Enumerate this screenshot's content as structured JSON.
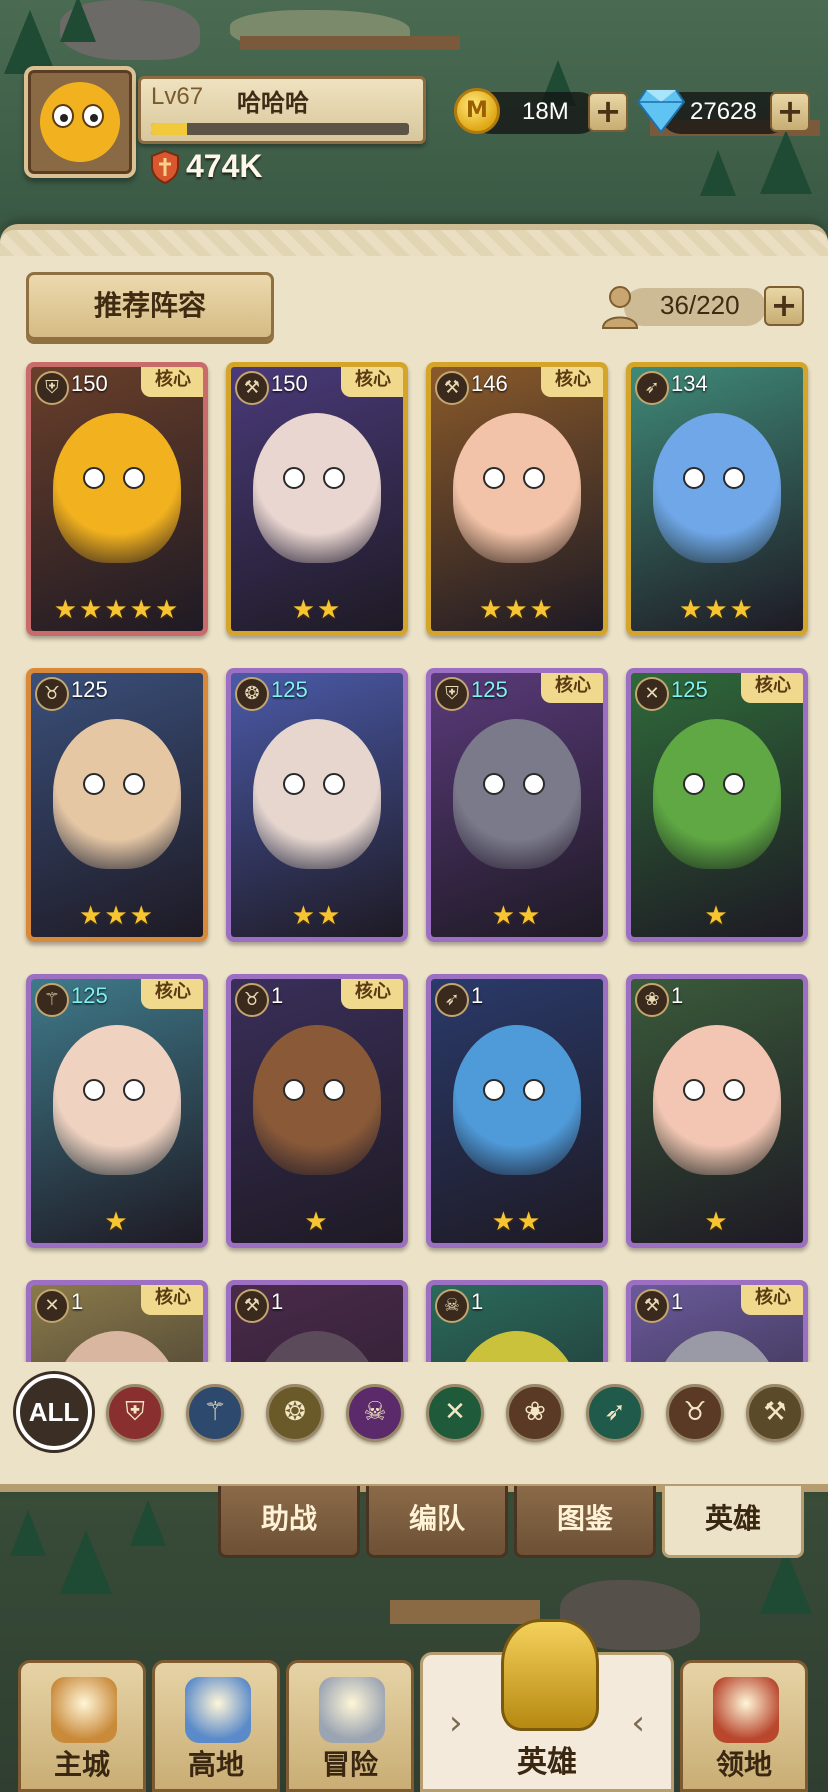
{
  "player": {
    "level_label": "Lv67",
    "name": "哈哈哈",
    "xp_fraction": 0.14,
    "power": "474K"
  },
  "currencies": {
    "gold": {
      "icon": "gold-coin-icon",
      "value": "18M",
      "plus": "+"
    },
    "gems": {
      "icon": "diamond-icon",
      "value": "27628",
      "plus": "+"
    }
  },
  "panel": {
    "recommend_label": "推荐阵容",
    "capacity": "36/220",
    "capacity_plus": "+"
  },
  "heroes": [
    {
      "class_icon": "shield-icon",
      "level": "150",
      "core": "核心",
      "stars": "★★★★★",
      "frame": "red",
      "skin": "#f2b21f",
      "bg": "#6a3f2a",
      "level_color": "white"
    },
    {
      "class_icon": "hammer-icon",
      "level": "150",
      "core": "核心",
      "stars": "★★",
      "frame": "gold",
      "skin": "#e9d6d0",
      "bg": "#4a3a7a",
      "level_color": "white"
    },
    {
      "class_icon": "hammer-icon",
      "level": "146",
      "core": "核心",
      "stars": "★★★",
      "frame": "gold",
      "skin": "#f2c3a8",
      "bg": "#8a5a2a",
      "level_color": "white"
    },
    {
      "class_icon": "bow-icon",
      "level": "134",
      "core": "",
      "stars": "★★★",
      "frame": "gold",
      "skin": "#6fa7e8",
      "bg": "#3f8a78",
      "level_color": "white"
    },
    {
      "class_icon": "horned-skull-icon",
      "level": "125",
      "core": "",
      "stars": "★★★",
      "frame": "orange",
      "skin": "#e6c7a4",
      "bg": "#3a4f7a",
      "level_color": "white"
    },
    {
      "class_icon": "phoenix-icon",
      "level": "125",
      "core": "",
      "stars": "★★",
      "frame": "purple",
      "skin": "#e6d6ce",
      "bg": "#4a5aa8",
      "level_color": "cyan"
    },
    {
      "class_icon": "shield-icon",
      "level": "125",
      "core": "核心",
      "stars": "★★",
      "frame": "purple",
      "skin": "#7a7a8a",
      "bg": "#5a3a7a",
      "level_color": "cyan"
    },
    {
      "class_icon": "daggers-icon",
      "level": "125",
      "core": "核心",
      "stars": "★",
      "frame": "purple",
      "skin": "#5fa843",
      "bg": "#2f6a3a",
      "level_color": "cyan"
    },
    {
      "class_icon": "staff-icon",
      "level": "125",
      "core": "核心",
      "stars": "★",
      "frame": "purple",
      "skin": "#f0d2c0",
      "bg": "#3f7a8a",
      "level_color": "cyan"
    },
    {
      "class_icon": "horned-skull-icon",
      "level": "1",
      "core": "核心",
      "stars": "★",
      "frame": "purple",
      "skin": "#8a5a38",
      "bg": "#3a2f5a",
      "level_color": "white"
    },
    {
      "class_icon": "bow-icon",
      "level": "1",
      "core": "",
      "stars": "★★",
      "frame": "purple",
      "skin": "#4f9ad8",
      "bg": "#2a3a6a",
      "level_color": "white"
    },
    {
      "class_icon": "paw-icon",
      "level": "1",
      "core": "",
      "stars": "★",
      "frame": "purple",
      "skin": "#f2c6b2",
      "bg": "#3a5a3a",
      "level_color": "white"
    },
    {
      "class_icon": "daggers-icon",
      "level": "1",
      "core": "核心",
      "stars": "",
      "frame": "purple",
      "skin": "#d9b6a0",
      "bg": "#8a7a4a",
      "level_color": "white"
    },
    {
      "class_icon": "hammer-icon",
      "level": "1",
      "core": "",
      "stars": "",
      "frame": "purple",
      "skin": "#5a4a5a",
      "bg": "#4a2a4a",
      "level_color": "white"
    },
    {
      "class_icon": "skull-icon",
      "level": "1",
      "core": "",
      "stars": "",
      "frame": "purple",
      "skin": "#c9c23a",
      "bg": "#2a6a5a",
      "level_color": "white"
    },
    {
      "class_icon": "hammer-icon",
      "level": "1",
      "core": "核心",
      "stars": "",
      "frame": "purple",
      "skin": "#9a9aa6",
      "bg": "#6a5a9a",
      "level_color": "white"
    }
  ],
  "filters": {
    "all_label": "ALL",
    "items": [
      {
        "icon": "shield-icon",
        "glyph": "⛨",
        "color": "#8a2f2f"
      },
      {
        "icon": "staff-icon",
        "glyph": "⚚",
        "color": "#2d4a6e"
      },
      {
        "icon": "phoenix-icon",
        "glyph": "❂",
        "color": "#6a5a2a"
      },
      {
        "icon": "skull-icon",
        "glyph": "☠",
        "color": "#5a2a6a"
      },
      {
        "icon": "daggers-icon",
        "glyph": "✕",
        "color": "#1f5a3a"
      },
      {
        "icon": "paw-icon",
        "glyph": "❀",
        "color": "#5a3a24"
      },
      {
        "icon": "bow-icon",
        "glyph": "➶",
        "color": "#1f5a4a"
      },
      {
        "icon": "horned-skull-icon",
        "glyph": "♉",
        "color": "#5a3a24"
      },
      {
        "icon": "hammer-icon",
        "glyph": "⚒",
        "color": "#5a4a2a"
      }
    ]
  },
  "subtabs": [
    {
      "label": "助战",
      "active": false
    },
    {
      "label": "编队",
      "active": false
    },
    {
      "label": "图鉴",
      "active": false
    },
    {
      "label": "英雄",
      "active": true
    }
  ],
  "bottom_nav": [
    {
      "label": "主城",
      "icon": "castle-icon",
      "color": "#c98a3a"
    },
    {
      "label": "高地",
      "icon": "highland-icon",
      "color": "#5a8ac9"
    },
    {
      "label": "冒险",
      "icon": "crossed-swords-icon",
      "color": "#9aa4b2"
    },
    {
      "label": "英雄",
      "icon": "hero-helmet-icon",
      "color": "#e0b12a"
    },
    {
      "label": "领地",
      "icon": "banner-icon",
      "color": "#b8472e"
    }
  ]
}
